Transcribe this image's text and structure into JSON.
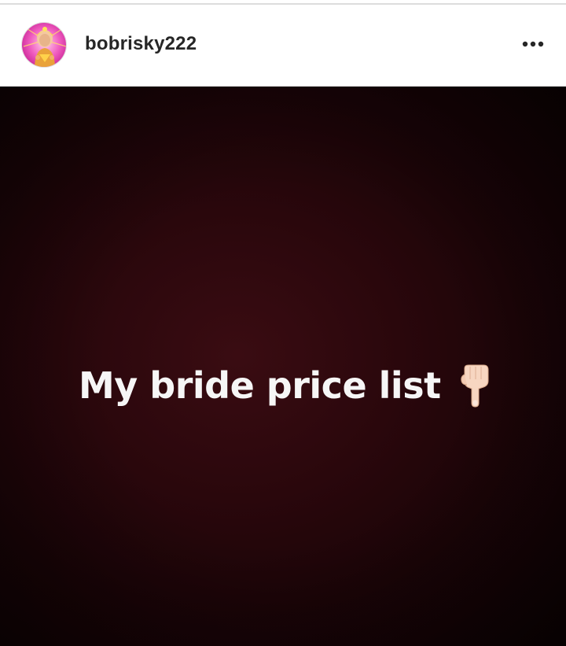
{
  "post": {
    "username": "bobrisky222",
    "avatar_icon": "profile-photo",
    "more_icon": "more-options-icon",
    "image": {
      "caption": "My bride price list",
      "emoji_icon": "pointing-down-hand-icon",
      "background_color": "#2a070c"
    }
  },
  "colors": {
    "header_bg": "#ffffff",
    "username_text": "#262626",
    "caption_text": "#f6f6f6"
  }
}
